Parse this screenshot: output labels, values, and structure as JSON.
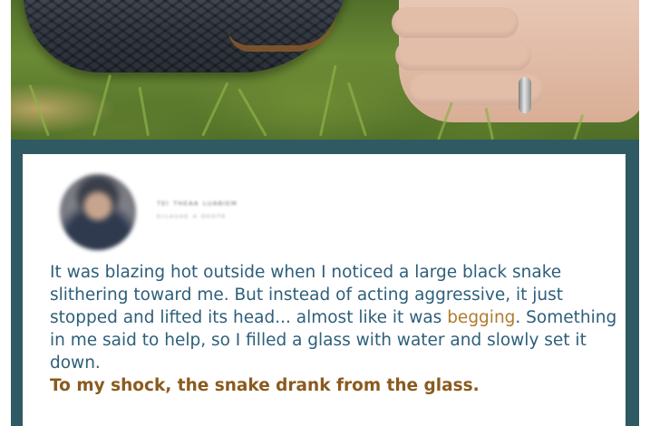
{
  "post": {
    "author_name": "ᵀᴱᴵ ᵀᴴᴱᴬᴬ ᴸᵁᴬᴮᴵᴱᴹ",
    "author_meta": "ᴱᶜᴸᴬᵁᴬᴱ ᴬ ᴰᴷᴼᵀᴿ",
    "text_before_highlight": "It was blazing hot outside when I noticed a large black snake slithering toward me. But instead of acting aggressive, it just stopped and lifted its head... almost like it was ",
    "highlight_word": "begging",
    "text_after_highlight": ". Something in me said to help, so I filled a glass with water and slowly set it down.",
    "bold_line": "To my shock, the snake drank from the glass."
  },
  "colors": {
    "frame": "#2f5a63",
    "body_text": "#2e5f7a",
    "highlight": "#b07a2e",
    "bold_text": "#8a5a1e"
  }
}
